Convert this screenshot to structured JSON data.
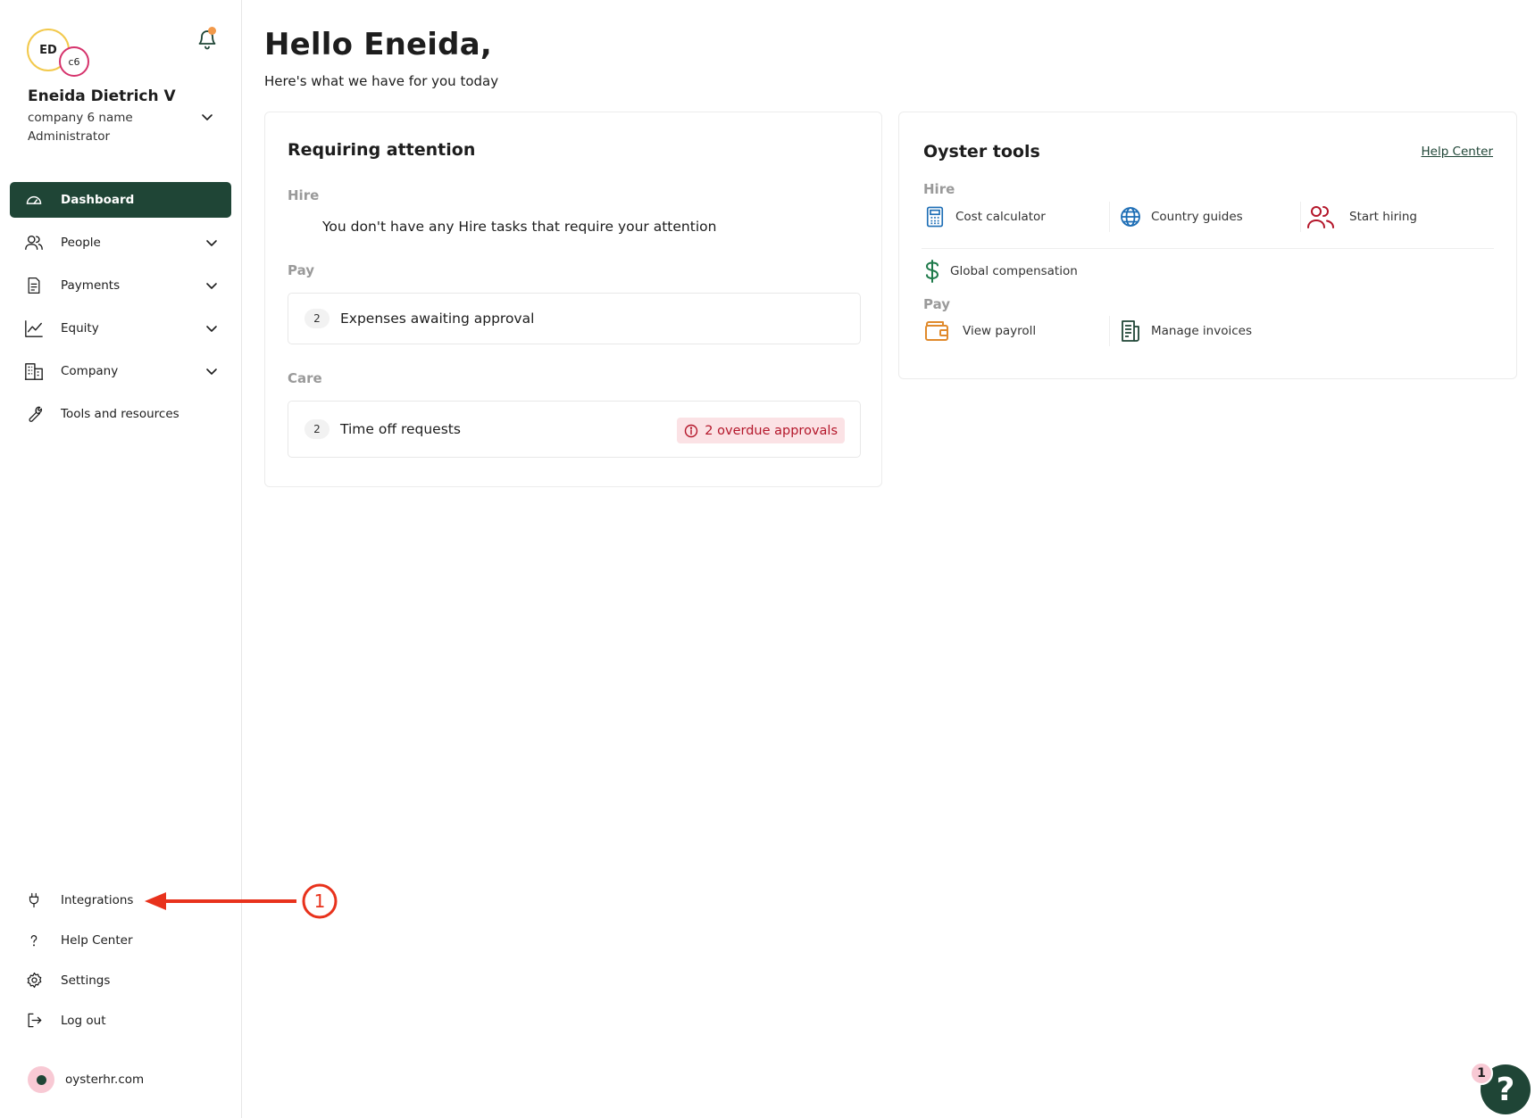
{
  "user": {
    "initials": "ED",
    "company_initials": "c6",
    "name": "Eneida Dietrich V",
    "company": "company 6 name",
    "role": "Administrator"
  },
  "nav": {
    "items": [
      {
        "label": "Dashboard",
        "icon": "dashboard-gauge-icon",
        "active": true
      },
      {
        "label": "People",
        "icon": "people-icon",
        "expandable": true
      },
      {
        "label": "Payments",
        "icon": "document-icon",
        "expandable": true
      },
      {
        "label": "Equity",
        "icon": "line-chart-icon",
        "expandable": true
      },
      {
        "label": "Company",
        "icon": "building-icon",
        "expandable": true
      },
      {
        "label": "Tools and resources",
        "icon": "wrench-icon"
      }
    ],
    "bottom": [
      {
        "label": "Integrations",
        "icon": "plug-icon"
      },
      {
        "label": "Help Center",
        "icon": "question-icon"
      },
      {
        "label": "Settings",
        "icon": "gear-icon"
      },
      {
        "label": "Log out",
        "icon": "logout-icon"
      }
    ],
    "site": "oysterhr.com"
  },
  "annotation": {
    "number": "1",
    "color": "#e8321c"
  },
  "greeting": {
    "title": "Hello Eneida,",
    "subtitle": "Here's what we have for you today"
  },
  "attention": {
    "title": "Requiring attention",
    "hire_label": "Hire",
    "hire_empty": "You don't have any Hire tasks that require your attention",
    "pay_label": "Pay",
    "pay_task": {
      "count": "2",
      "label": "Expenses awaiting approval"
    },
    "care_label": "Care",
    "care_task": {
      "count": "2",
      "label": "Time off requests",
      "badge": "2 overdue approvals"
    }
  },
  "tools": {
    "title": "Oyster tools",
    "help_link": "Help Center",
    "hire_label": "Hire",
    "hire_tools": [
      {
        "label": "Cost calculator",
        "icon": "calculator-icon"
      },
      {
        "label": "Country guides",
        "icon": "globe-icon"
      },
      {
        "label": "Start hiring",
        "icon": "people-add-icon"
      },
      {
        "label": "Global compensation",
        "icon": "dollar-icon"
      }
    ],
    "pay_label": "Pay",
    "pay_tools": [
      {
        "label": "View payroll",
        "icon": "wallet-icon"
      },
      {
        "label": "Manage invoices",
        "icon": "invoice-icon"
      }
    ]
  },
  "help_widget": {
    "count": "1",
    "symbol": "?"
  },
  "colors": {
    "accent": "#1f4536",
    "alert": "#b4162a",
    "alert_bg": "#fbe2e5",
    "annotation": "#e8321c"
  }
}
